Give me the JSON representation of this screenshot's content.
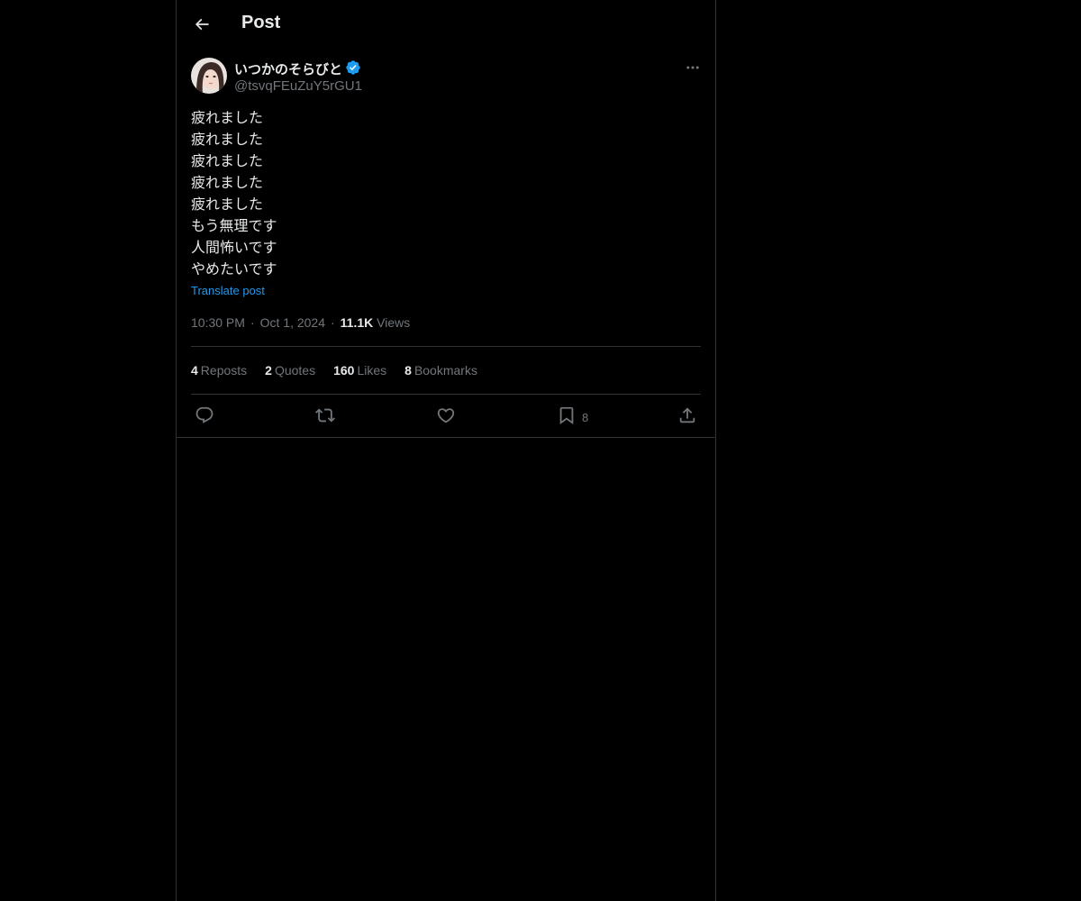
{
  "header": {
    "title": "Post"
  },
  "author": {
    "display_name": "いつかのそらびと",
    "handle": "@tsvqFEuZuY5rGU1",
    "verified": true
  },
  "post": {
    "lines": [
      "疲れました",
      "疲れました",
      "疲れました",
      "疲れました",
      "疲れました",
      "もう無理です",
      "人間怖いです",
      "やめたいです"
    ],
    "translate_label": "Translate post",
    "time": "10:30 PM",
    "separator": "·",
    "date": "Oct 1, 2024",
    "views_count": "11.1K",
    "views_label": "Views"
  },
  "stats": {
    "reposts": {
      "count": "4",
      "label": "Reposts"
    },
    "quotes": {
      "count": "2",
      "label": "Quotes"
    },
    "likes": {
      "count": "160",
      "label": "Likes"
    },
    "bookmarks": {
      "count": "8",
      "label": "Bookmarks"
    }
  },
  "actions": {
    "bookmark_count": "8"
  },
  "icons": {
    "back": "arrow-left-icon",
    "verified": "verified-badge-icon",
    "more": "more-horizontal-icon",
    "reply": "reply-icon",
    "repost": "repost-icon",
    "like": "heart-icon",
    "bookmark": "bookmark-icon",
    "share": "share-icon"
  },
  "colors": {
    "background": "#000000",
    "text": "#e7e9ea",
    "secondary": "#71767b",
    "accent": "#1d9bf0",
    "border": "#2f3336"
  }
}
